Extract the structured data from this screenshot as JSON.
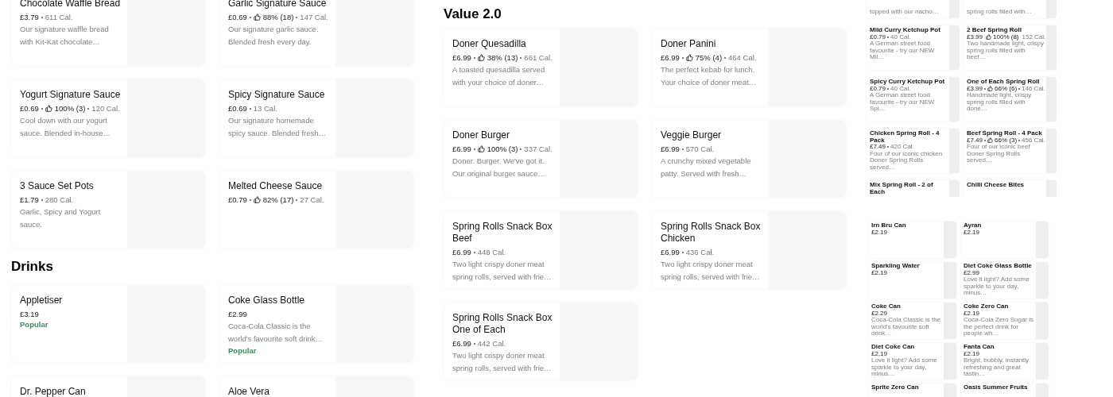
{
  "panels": [
    {
      "kind": "large",
      "sections": [
        {
          "items": [
            {
              "title": "Chocolate Waffle Bread",
              "price": "£3.79",
              "calories": "611 Cal.",
              "description": "Our signature waffle bread with Kit-Kat chocolate…"
            },
            {
              "title": "Garlic Signature Sauce",
              "price": "£0.69",
              "rating": "88% (18)",
              "calories": "147 Cal.",
              "description": "Our signature garlic sauce. Blended fresh every day."
            },
            {
              "title": "Yogurt Signature Sauce",
              "price": "£0.69",
              "rating": "100% (3)",
              "calories": "120 Cal.",
              "description": "Cool down with our yogurt sauce. Blended in-house…"
            },
            {
              "title": "Spicy Signature Sauce",
              "price": "£0.69",
              "calories": "13 Cal.",
              "description": "Our signature homemade spicy sauce. Blended fresh…"
            },
            {
              "title": "3 Sauce Set Pots",
              "price": "£1.79",
              "calories": "280 Cal.",
              "description": "Garlic, Spicy and Yogurt sauce."
            },
            {
              "title": "Melted Cheese Sauce",
              "price": "£0.79",
              "rating": "82% (17)",
              "calories": "27 Cal."
            }
          ]
        },
        {
          "heading": "Drinks",
          "items": [
            {
              "title": "Appletiser",
              "price": "£3.19",
              "badge": "Popular"
            },
            {
              "title": "Coke Glass Bottle",
              "price": "£2.99",
              "description": "Coca-Cola Classic is the world's favourite soft drink…",
              "badge": "Popular"
            },
            {
              "title": "Dr. Pepper Can"
            },
            {
              "title": "Aloe Vera"
            }
          ]
        }
      ]
    },
    {
      "kind": "large",
      "sections": [
        {
          "heading": "Value 2.0",
          "items": [
            {
              "title": "Doner Quesadilla",
              "price": "£6.99",
              "rating": "38% (13)",
              "calories": "661 Cal.",
              "description": "A toasted quesadilla served with your choice of doner…"
            },
            {
              "title": "Doner Panini",
              "price": "£6.99",
              "rating": "75% (4)",
              "calories": "464 Cal.",
              "description": "The perfect kebab for lunch. Your choice of doner meat…"
            },
            {
              "title": "Doner Burger",
              "price": "£6.99",
              "rating": "100% (3)",
              "calories": "337 Cal.",
              "description": "Doner. Burger. We've got it. Our original burger sauce…"
            },
            {
              "title": "Veggie Burger",
              "price": "£6.99",
              "calories": "570 Cal.",
              "description": "A crunchy mixed vegetable patty. Served with fresh…"
            },
            {
              "title": "Spring Rolls Snack Box Beef",
              "price": "£6.99",
              "calories": "448 Cal.",
              "description": "Two light crispy doner meat spring rolls, served with frie…"
            },
            {
              "title": "Spring Rolls Snack Box Chicken",
              "price": "£6.99",
              "calories": "436 Cal.",
              "description": "Two light crispy doner meat spring rolls, served with frie…"
            },
            {
              "title": "Spring Rolls Snack Box One of Each",
              "price": "£6.99",
              "calories": "442 Cal.",
              "description": "Two light crispy doner meat spring rolls, served with frie…"
            }
          ]
        }
      ]
    },
    {
      "kind": "medium",
      "sections": [
        {
          "items": [
            {
              "description": "topped with our nacho…"
            },
            {
              "description": "spring rolls filled with…"
            },
            {
              "title": "Mild Curry Ketchup Pot",
              "price": "£0.79",
              "calories": "40 Cal.",
              "description": "A German street food favourite - try our NEW Mil…"
            },
            {
              "title": "2 Beef Spring Roll",
              "price": "£3.99",
              "rating": "100% (8)",
              "calories": "152 Cal.",
              "description": "Two handmade light, crispy spring rolls filled with beef…"
            },
            {
              "title": "Spicy Curry Ketchup Pot",
              "price": "£0.79",
              "calories": "40 Cal.",
              "description": "A German street food favourite - try our NEW Spi…"
            },
            {
              "title": "One of Each Spring Roll",
              "price": "£3.99",
              "rating": "66% (6)",
              "calories": "146 Cal.",
              "description": "Handmade light, crispy spring rolls filled with done…"
            },
            {
              "title": "Chicken Spring Roll - 4 Pack",
              "price": "£7.49",
              "calories": "420 Cal.",
              "description": "Four of our iconic chicken Doner Spring Rolls served…"
            },
            {
              "title": "Beef Spring Roll - 4 Pack",
              "price": "£7.49",
              "rating": "66% (3)",
              "calories": "456 Cal.",
              "description": "Four of our iconic beef Doner Spring Rolls served…"
            },
            {
              "title": "Mix Spring Roll - 2 of Each"
            },
            {
              "title": "Chilli Cheese Bites"
            }
          ]
        }
      ]
    },
    {
      "kind": "small",
      "sections": [
        {
          "items": [
            {
              "title": "Irn Bru Can",
              "price": "£2.19"
            },
            {
              "title": "Ayran",
              "price": "£2.19"
            },
            {
              "title": "Sparkling Water",
              "price": "£2.19"
            },
            {
              "title": "Diet Coke Glass Bottle",
              "price": "£2.99",
              "description": "Love it light? Add some sparkle to your day, minus…"
            },
            {
              "title": "Coke Can",
              "price": "£2.29",
              "description": "Coca-Cola Classic is the world's favourite soft drink…"
            },
            {
              "title": "Coke Zero Can",
              "price": "£2.19",
              "description": "Coca-Cola Zero Sugar is the perfect drink for people wh…"
            },
            {
              "title": "Diet Coke Can",
              "price": "£2.19",
              "description": "Love it light? Add some sparkle to your day, minus…"
            },
            {
              "title": "Fanta Can",
              "price": "£2.19",
              "description": "Bright, bubbly, instantly refreshing and great tastin…"
            },
            {
              "title": "Sprite Zero Can"
            },
            {
              "title": "Oasis Summer Fruits"
            }
          ]
        }
      ]
    }
  ]
}
